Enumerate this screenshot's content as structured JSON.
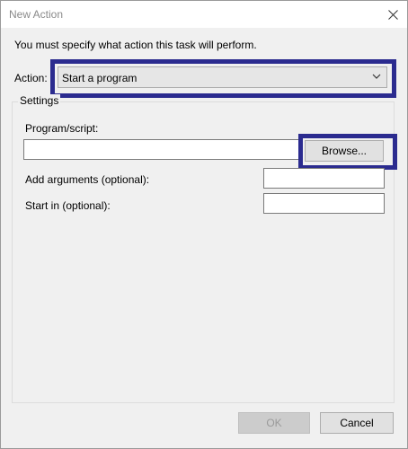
{
  "window": {
    "title": "New Action"
  },
  "instruction": "You must specify what action this task will perform.",
  "action": {
    "label": "Action:",
    "selected": "Start a program"
  },
  "settings": {
    "group_label": "Settings",
    "program_label": "Program/script:",
    "program_value": "",
    "browse_label": "Browse...",
    "arguments_label": "Add arguments (optional):",
    "arguments_value": "",
    "start_in_label": "Start in (optional):",
    "start_in_value": ""
  },
  "footer": {
    "ok_label": "OK",
    "cancel_label": "Cancel"
  },
  "colors": {
    "highlight": "#2b2b8f",
    "dialog_bg": "#f0f0f0"
  }
}
